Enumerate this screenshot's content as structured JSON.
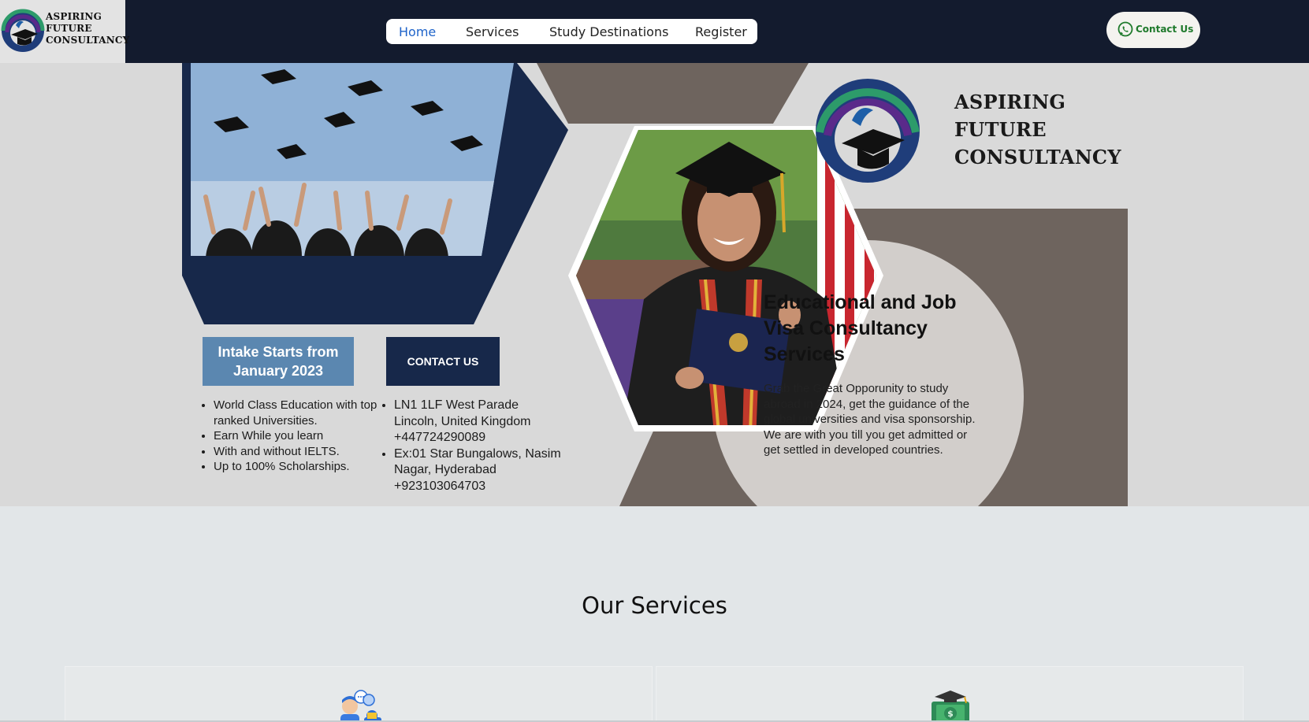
{
  "logo": {
    "icon": "graduation-cap-logo-icon",
    "lines": [
      "ASPIRING",
      "FUTURE",
      "CONSULTANCY"
    ]
  },
  "nav": {
    "items": [
      {
        "label": "Home",
        "active": true
      },
      {
        "label": "Services",
        "active": false
      },
      {
        "label": "Study Destinations",
        "active": false
      },
      {
        "label": "Register",
        "active": false
      }
    ],
    "contact_label": "Contact Us",
    "contact_icon": "whatsapp-icon"
  },
  "hero": {
    "brand_lines": [
      "ASPIRING",
      "FUTURE",
      "CONSULTANCY"
    ],
    "intake": "Intake Starts from January 2023",
    "contact_heading": "CONTACT US",
    "left_bullets": [
      "World Class Education with top ranked Universities.",
      "Earn While you learn",
      "With and without IELTS.",
      "Up to 100% Scholarships."
    ],
    "right_bullets": [
      "LN1 1LF West Parade Lincoln, United Kingdom +447724290089",
      "Ex:01 Star Bungalows, Nasim Nagar, Hyderabad +923103064703"
    ],
    "title": "Educational and Job Visa Consultancy Services",
    "body": "Grab the Great Opporunity to study abroad in 2024, get the guidance of the global universities and visa sponsorship. We are with you till you get admitted or get settled in developed countries.",
    "colors": {
      "navy": "#17284a",
      "taupe": "#6e645e",
      "steel_blue": "#5b87b0"
    }
  },
  "services": {
    "title": "Our Services",
    "cards": [
      {
        "icon": "consultation-people-icon"
      },
      {
        "icon": "graduation-money-icon"
      }
    ]
  },
  "colors": {
    "navbar": "#131b2e",
    "active_link": "#1e63c9",
    "whatsapp_green": "#1f7a2c"
  }
}
